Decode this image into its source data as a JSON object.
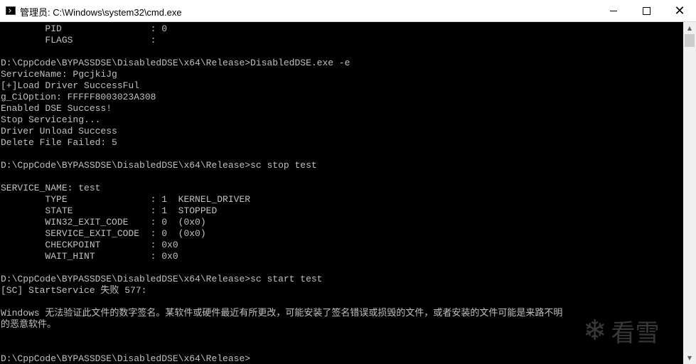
{
  "window": {
    "title": "管理员: C:\\Windows\\system32\\cmd.exe",
    "minimize_glyph": "",
    "close_glyph": "✕"
  },
  "console": {
    "lines": [
      "        PID                : 0",
      "        FLAGS              :",
      "",
      "D:\\CppCode\\BYPASSDSE\\DisabledDSE\\x64\\Release>DisabledDSE.exe -e",
      "ServiceName: PgcjkiJg",
      "[+]Load Driver SuccessFul",
      "g_CiOption: FFFFF8003023A308",
      "Enabled DSE Success!",
      "Stop Serviceing...",
      "Driver Unload Success",
      "Delete File Failed: 5",
      "",
      "D:\\CppCode\\BYPASSDSE\\DisabledDSE\\x64\\Release>sc stop test",
      "",
      "SERVICE_NAME: test",
      "        TYPE               : 1  KERNEL_DRIVER",
      "        STATE              : 1  STOPPED",
      "        WIN32_EXIT_CODE    : 0  (0x0)",
      "        SERVICE_EXIT_CODE  : 0  (0x0)",
      "        CHECKPOINT         : 0x0",
      "        WAIT_HINT          : 0x0",
      "",
      "D:\\CppCode\\BYPASSDSE\\DisabledDSE\\x64\\Release>sc start test",
      "[SC] StartService 失败 577:",
      "",
      "Windows 无法验证此文件的数字签名。某软件或硬件最近有所更改，可能安装了签名错误或损毁的文件，或者安装的文件可能是来路不明",
      "的恶意软件。",
      "",
      "",
      "D:\\CppCode\\BYPASSDSE\\DisabledDSE\\x64\\Release>"
    ]
  },
  "watermark": {
    "icon": "snowflake-icon",
    "text": "看雪"
  },
  "colors": {
    "console_bg": "#000000",
    "console_fg": "#c0c0c0",
    "titlebar_bg": "#ffffff"
  }
}
